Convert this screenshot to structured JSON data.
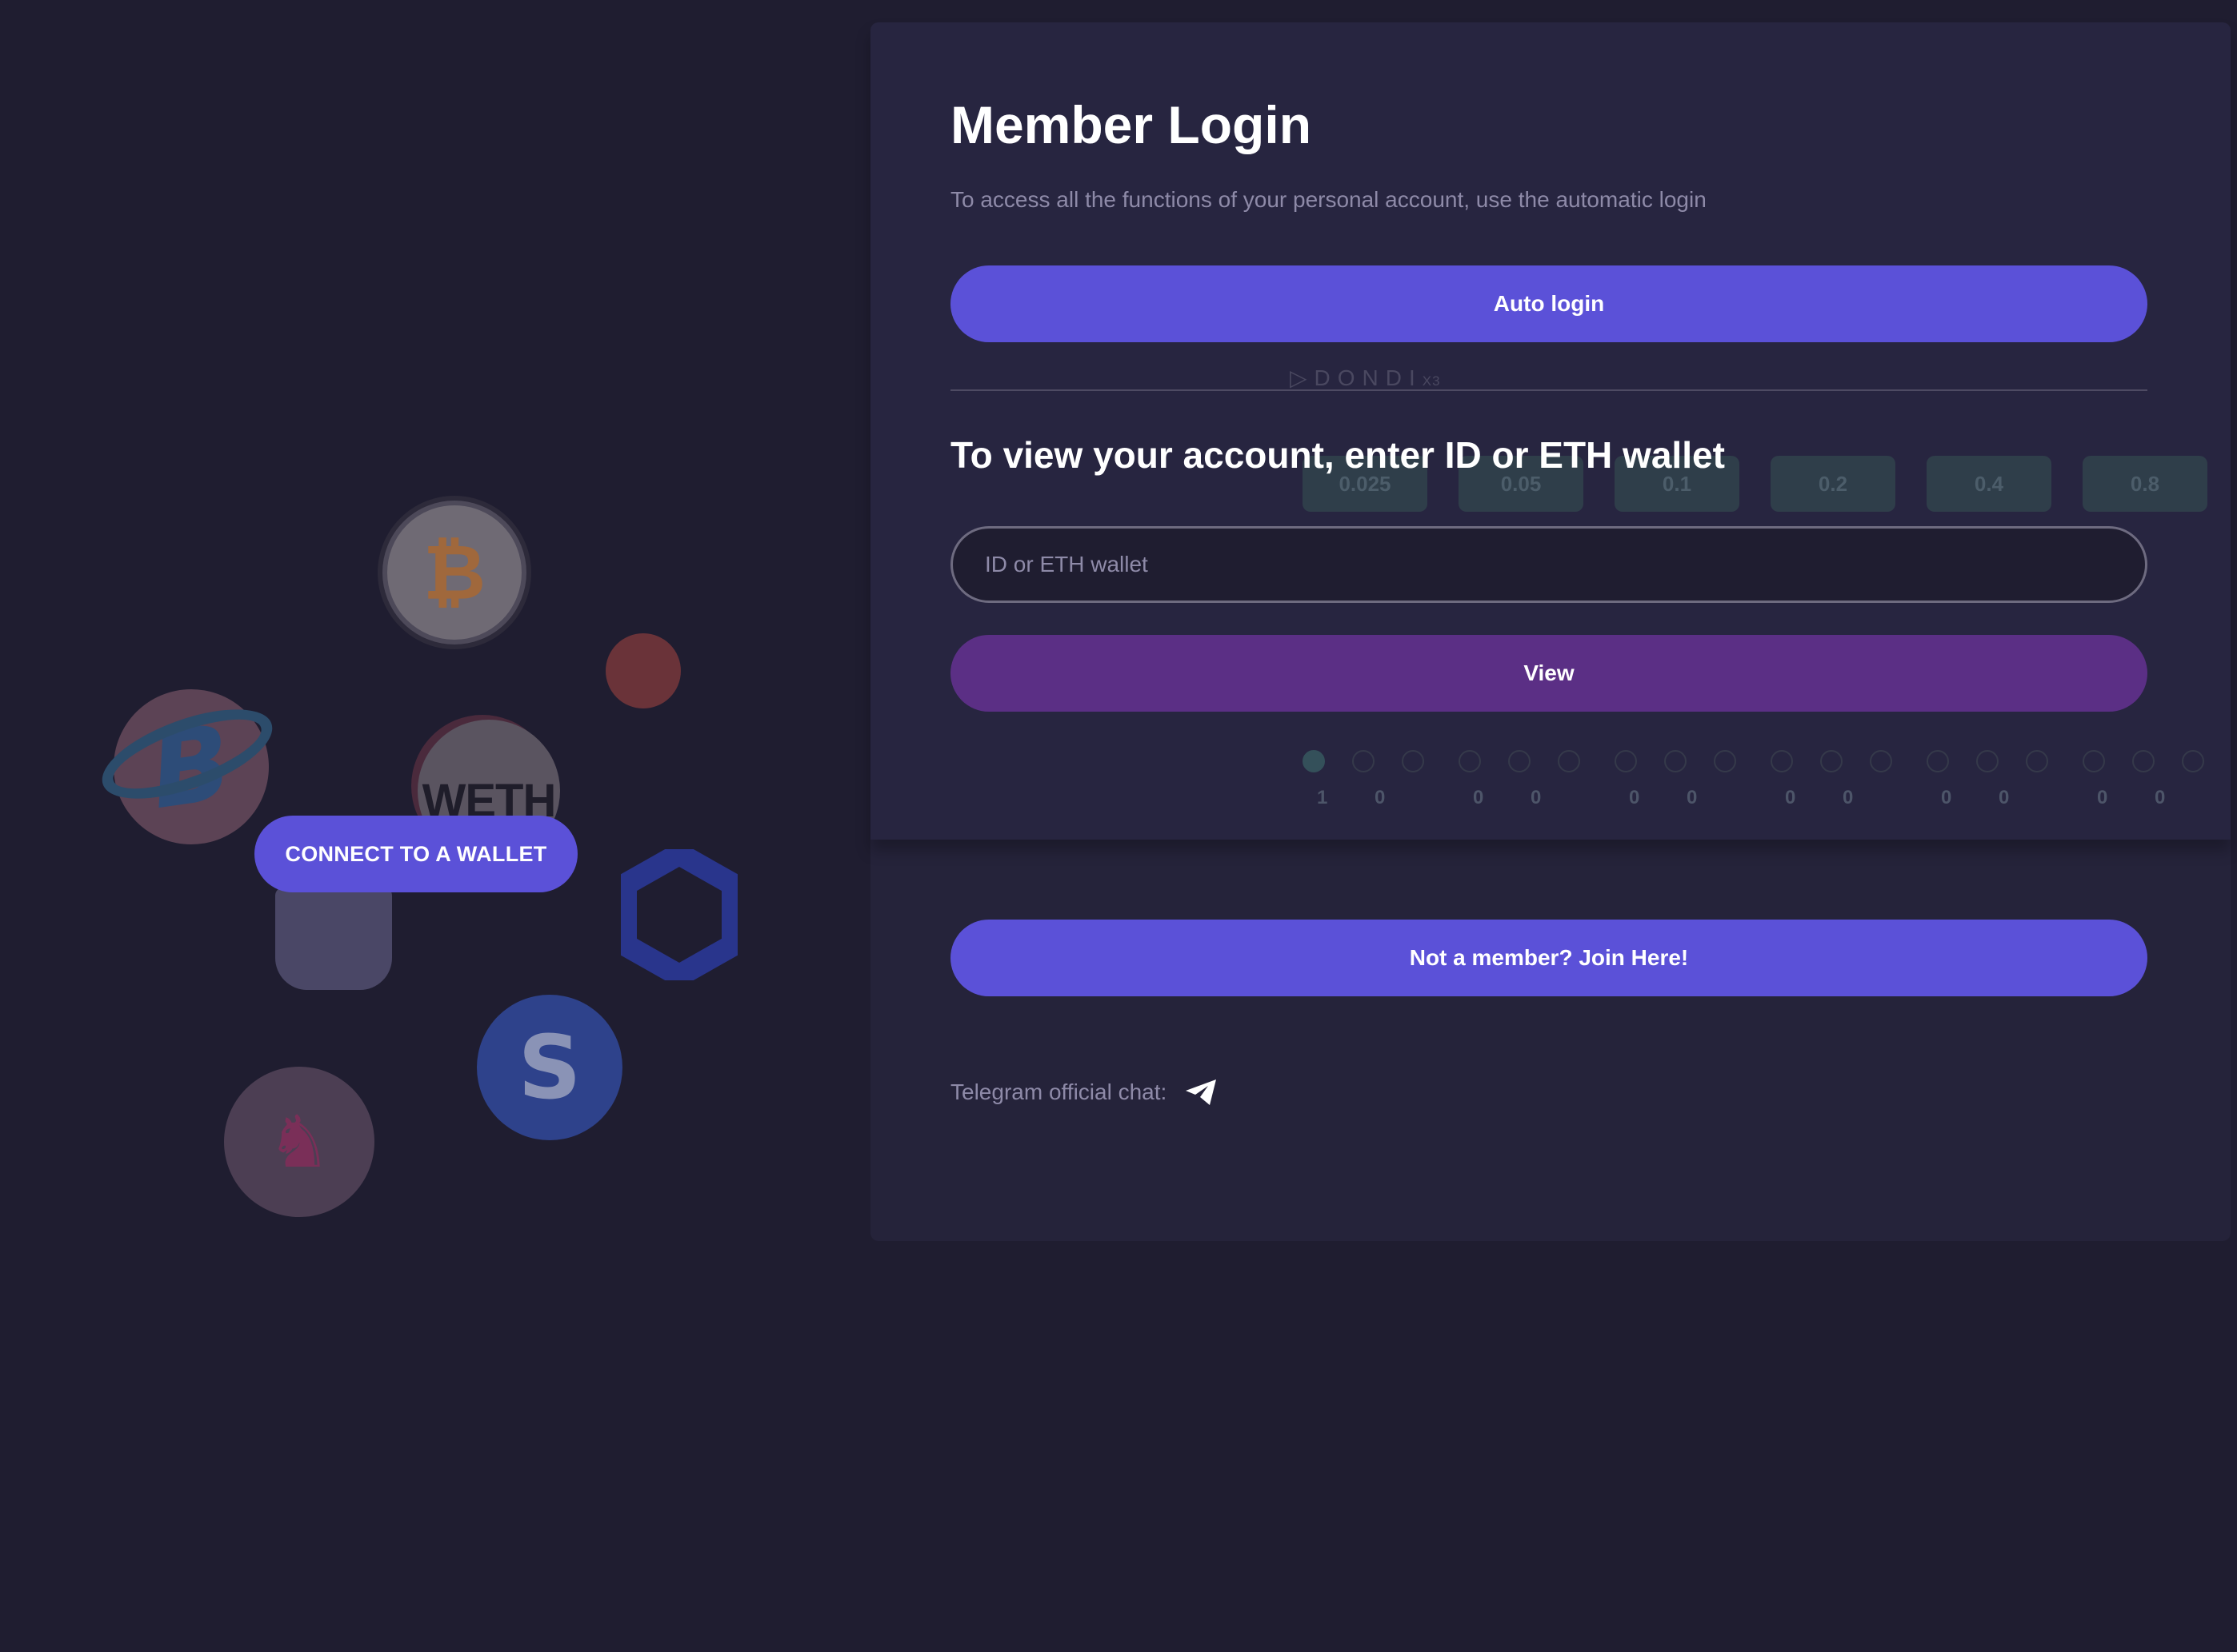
{
  "wallet_connect": {
    "button_label": "CONNECT TO A WALLET"
  },
  "decor_coins": {
    "btc_symbol": "₿",
    "b_symbol": "B",
    "weth_label": "WETH",
    "yearn_symbol": "S",
    "uni_symbol": "♞"
  },
  "login": {
    "title": "Member Login",
    "subtitle": "To access all the functions of your personal account, use the automatic login",
    "auto_login_label": "Auto login",
    "brand_watermark": "DONDI",
    "brand_suffix": "X3",
    "view_heading": "To view your account, enter ID or ETH wallet",
    "input_placeholder": "ID or ETH wallet",
    "view_label": "View",
    "join_label": "Not a member? Join Here!",
    "telegram_label": "Telegram official chat:"
  },
  "background_matrix": {
    "levels": [
      "0.025",
      "0.05",
      "0.1",
      "0.2",
      "0.4",
      "0.8"
    ],
    "stats": [
      "1",
      "0",
      "0",
      "0",
      "0",
      "0",
      "0",
      "0",
      "0",
      "0",
      "0",
      "0"
    ]
  },
  "colors": {
    "background": "#1f1d30",
    "panel": "#25233a",
    "primary_button": "#5b51d8",
    "view_button": "#5b2f85"
  }
}
